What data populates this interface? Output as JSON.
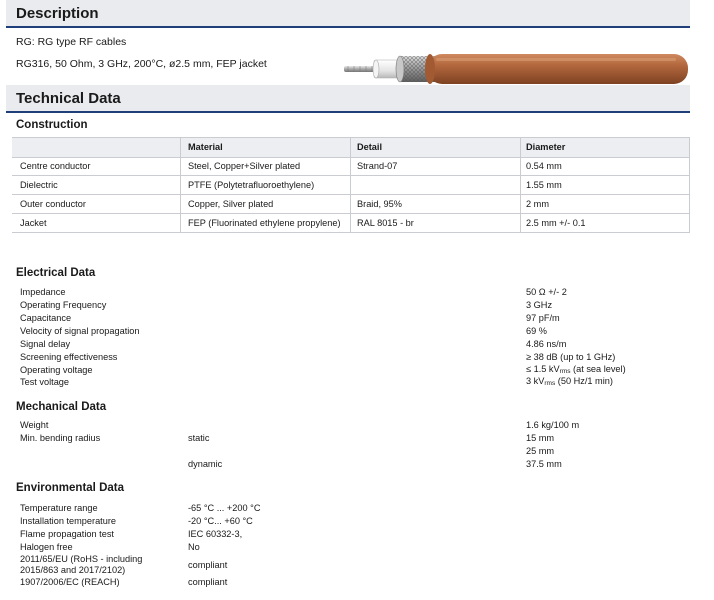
{
  "description": {
    "title": "Description",
    "line1": "RG: RG type RF cables",
    "line2": "RG316, 50 Ohm, 3 GHz, 200°C, ø2.5 mm, FEP jacket"
  },
  "technical": {
    "title": "Technical Data"
  },
  "construction": {
    "title": "Construction",
    "headers": [
      "Material",
      "Detail",
      "Diameter"
    ],
    "rows": [
      {
        "name": "Centre conductor",
        "material": "Steel, Copper+Silver plated",
        "detail": "Strand-07",
        "diameter": "0.54 mm"
      },
      {
        "name": "Dielectric",
        "material": "PTFE (Polytetrafluoroethylene)",
        "detail": "",
        "diameter": "1.55 mm"
      },
      {
        "name": "Outer conductor",
        "material": "Copper, Silver plated",
        "detail": "Braid, 95%",
        "diameter": "2 mm"
      },
      {
        "name": "Jacket",
        "material": "FEP (Fluorinated ethylene propylene)",
        "detail": "RAL 8015 - br",
        "diameter": "2.5 mm +/- 0.1"
      }
    ]
  },
  "electrical": {
    "title": "Electrical Data",
    "rows": [
      {
        "label": "Impedance",
        "value": "50 Ω +/- 2"
      },
      {
        "label": "Operating Frequency",
        "value": "3 GHz"
      },
      {
        "label": "Capacitance",
        "value": "97 pF/m"
      },
      {
        "label": "Velocity of signal propagation",
        "value": "69 %"
      },
      {
        "label": "Signal delay",
        "value": "4.86 ns/m"
      },
      {
        "label": "Screening effectiveness",
        "value": "≥ 38 dB (up to 1 GHz)"
      },
      {
        "label": "Operating voltage",
        "value_pre": "≤ 1.5 kV",
        "value_sub": "rms",
        "value_post": " (at sea level)"
      },
      {
        "label": "Test voltage",
        "value_pre": "3 kV",
        "value_sub": "rms",
        "value_post": " (50 Hz/1 min)"
      }
    ]
  },
  "mechanical": {
    "title": "Mechanical Data",
    "weight_label": "Weight",
    "weight_value": "1.6 kg/100 m",
    "bend_label": "Min. bending radius",
    "static_label": "static",
    "static_value_1": "15 mm",
    "static_value_2": "25 mm",
    "dynamic_label": "dynamic",
    "dynamic_value": "37.5 mm"
  },
  "environmental": {
    "title": "Environmental Data",
    "rows": [
      {
        "label": "Temperature range",
        "value": "-65 °C ... +200 °C"
      },
      {
        "label": "Installation temperature",
        "value": "-20 °C... +60 °C"
      },
      {
        "label": "Flame propagation test",
        "value": "IEC 60332-3,"
      },
      {
        "label": "Halogen free",
        "value": "No"
      },
      {
        "label_1": "2011/65/EU (RoHS - including",
        "label_2": "2015/863 and 2017/2102)",
        "value": "compliant"
      },
      {
        "label": "1907/2006/EC (REACH)",
        "value": "compliant"
      }
    ]
  },
  "colors": {
    "jacket": "#b5693f",
    "heading_rule": "#1f3f7a",
    "heading_bar": "#e9ebee"
  }
}
